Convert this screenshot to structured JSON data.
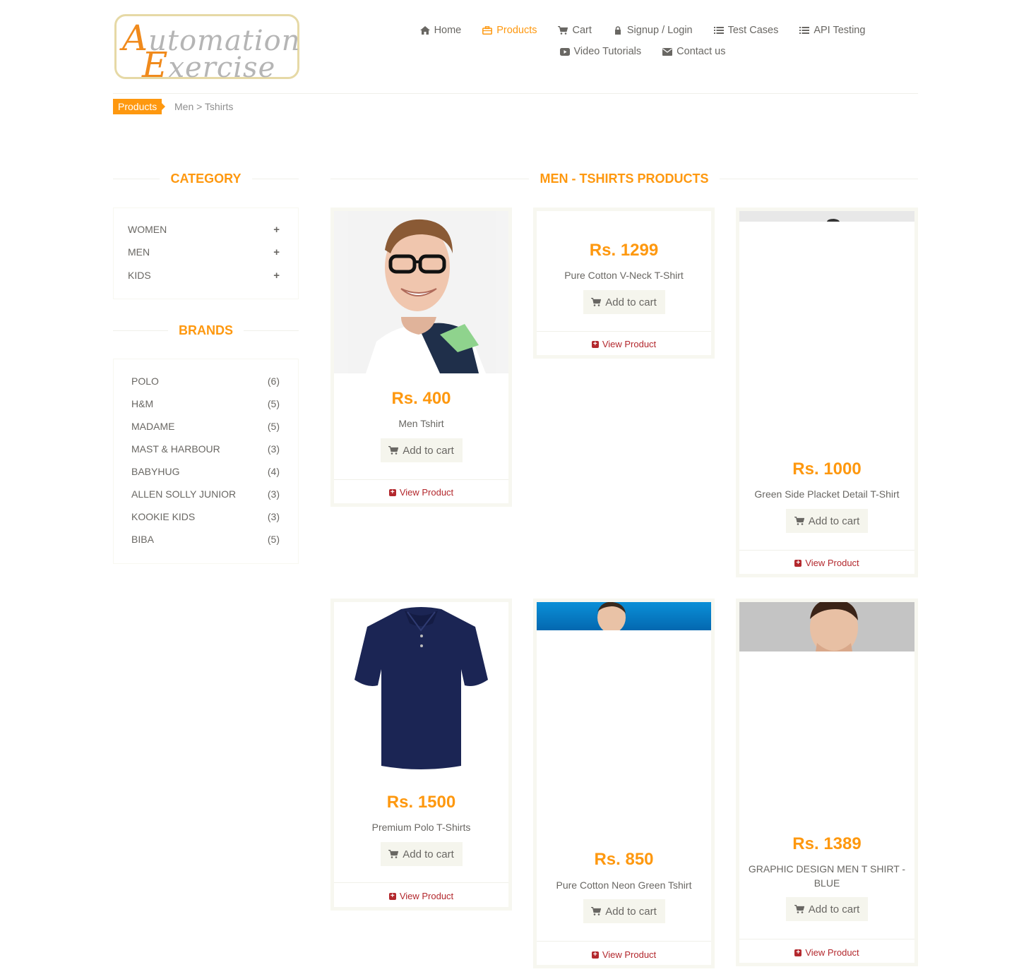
{
  "header": {
    "logo_first_word_initial": "A",
    "logo_first_word_rest": "utomation",
    "logo_second_word_initial": "E",
    "logo_second_word_rest": "xercise",
    "nav": [
      {
        "label": "Home",
        "icon": "home-icon",
        "glyph": "⌂",
        "active": false
      },
      {
        "label": "Products",
        "icon": "briefcase-icon",
        "glyph": "▭",
        "active": true
      },
      {
        "label": "Cart",
        "icon": "shopping-cart-icon",
        "glyph": "🛒",
        "active": false
      },
      {
        "label": "Signup / Login",
        "icon": "lock-icon",
        "glyph": "🔒",
        "active": false
      },
      {
        "label": "Test Cases",
        "icon": "list-icon",
        "glyph": "☰",
        "active": false
      },
      {
        "label": "API Testing",
        "icon": "list-icon",
        "glyph": "☰",
        "active": false
      },
      {
        "label": "Video Tutorials",
        "icon": "youtube-play-icon",
        "glyph": "▶",
        "active": false
      },
      {
        "label": "Contact us",
        "icon": "envelope-icon",
        "glyph": "✉",
        "active": false
      }
    ]
  },
  "breadcrumb": {
    "active": "Products",
    "rest": "Men > Tshirts"
  },
  "sidebar": {
    "category_title": "CATEGORY",
    "categories": [
      "Women",
      "Men",
      "Kids"
    ],
    "brands_title": "BRANDS",
    "brands": [
      {
        "name": "POLO",
        "count": "(6)"
      },
      {
        "name": "H&M",
        "count": "(5)"
      },
      {
        "name": "MADAME",
        "count": "(5)"
      },
      {
        "name": "MAST & HARBOUR",
        "count": "(3)"
      },
      {
        "name": "BABYHUG",
        "count": "(4)"
      },
      {
        "name": "ALLEN SOLLY JUNIOR",
        "count": "(3)"
      },
      {
        "name": "KOOKIE KIDS",
        "count": "(3)"
      },
      {
        "name": "BIBA",
        "count": "(5)"
      }
    ]
  },
  "main": {
    "title": "MEN - TSHIRTS PRODUCTS",
    "add_to_cart_label": "Add to cart",
    "view_product_label": "View Product",
    "products": [
      {
        "price": "Rs. 400",
        "name": "Men Tshirt"
      },
      {
        "price": "Rs. 1299",
        "name": "Pure Cotton V-Neck T-Shirt"
      },
      {
        "price": "Rs. 1000",
        "name": "Green Side Placket Detail T-Shirt"
      },
      {
        "price": "Rs. 1500",
        "name": "Premium Polo T-Shirts"
      },
      {
        "price": "Rs. 850",
        "name": "Pure Cotton Neon Green Tshirt"
      },
      {
        "price": "Rs. 1389",
        "name": "GRAPHIC DESIGN MEN T SHIRT - BLUE"
      }
    ]
  },
  "colors": {
    "accent": "#fe980f",
    "text": "#696763",
    "link": "#b3282d"
  }
}
